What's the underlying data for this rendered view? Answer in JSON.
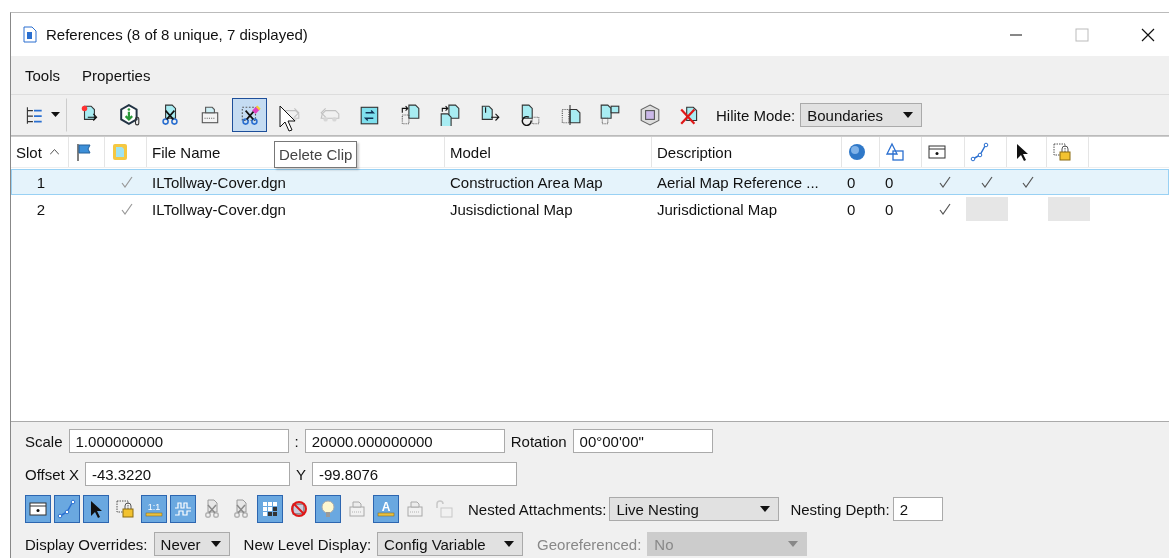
{
  "window": {
    "title": "References (8 of 8 unique, 7 displayed)"
  },
  "menu": [
    {
      "label": "Tools"
    },
    {
      "label": "Properties"
    }
  ],
  "toolbar": {
    "tools": [
      {
        "kind": "tree",
        "disabled": false,
        "selected": false
      },
      {
        "kind": "attach",
        "disabled": false,
        "selected": false
      },
      {
        "kind": "info",
        "disabled": false,
        "selected": false
      },
      {
        "kind": "clip",
        "disabled": false,
        "selected": false
      },
      {
        "kind": "mask",
        "disabled": false,
        "selected": false
      },
      {
        "kind": "clipdelete",
        "disabled": false,
        "selected": true
      },
      {
        "kind": "carright",
        "disabled": true,
        "selected": false
      },
      {
        "kind": "carleft",
        "disabled": true,
        "selected": false
      },
      {
        "kind": "reload",
        "disabled": false,
        "selected": false
      },
      {
        "kind": "copy",
        "disabled": false,
        "selected": false
      },
      {
        "kind": "move",
        "disabled": false,
        "selected": false
      },
      {
        "kind": "scale",
        "disabled": false,
        "selected": false
      },
      {
        "kind": "rotate",
        "disabled": false,
        "selected": false
      },
      {
        "kind": "mirrorh",
        "disabled": false,
        "selected": false
      },
      {
        "kind": "mirrorv",
        "disabled": false,
        "selected": false
      },
      {
        "kind": "cube",
        "disabled": false,
        "selected": false
      },
      {
        "kind": "detach",
        "disabled": false,
        "selected": false
      }
    ],
    "hilite": {
      "label": "Hilite Mode:",
      "value": "Boundaries"
    },
    "tooltip": "Delete Clip"
  },
  "table": {
    "columns": [
      {
        "kind": "text",
        "label": "Slot",
        "sorted": true
      },
      {
        "kind": "flag"
      },
      {
        "kind": "filedoc"
      },
      {
        "kind": "text",
        "label": "File Name",
        "sorted": false
      },
      {
        "kind": "text",
        "label": "Model",
        "sorted": false
      },
      {
        "kind": "text",
        "label": "Description",
        "sorted": false
      },
      {
        "kind": "globe"
      },
      {
        "kind": "shapes"
      },
      {
        "kind": "window"
      },
      {
        "kind": "line"
      },
      {
        "kind": "pointer"
      },
      {
        "kind": "lock"
      }
    ],
    "rows": [
      {
        "selected": true,
        "slot": "1",
        "loaded": true,
        "file_name": "ILTollway-Cover.dgn",
        "model": "Construction Area Map",
        "description": "Aerial Map Reference ...",
        "column_7": "0",
        "column_8": "0",
        "toggles": [
          {
            "checked": true,
            "disabled": false
          },
          {
            "checked": true,
            "disabled": false
          },
          {
            "checked": true,
            "disabled": false
          },
          {
            "checked": false,
            "disabled": false
          }
        ]
      },
      {
        "selected": false,
        "slot": "2",
        "loaded": true,
        "file_name": "ILTollway-Cover.dgn",
        "model": "Jusisdictional Map",
        "description": "Jurisdictional Map",
        "column_7": "0",
        "column_8": "0",
        "toggles": [
          {
            "checked": true,
            "disabled": false
          },
          {
            "checked": false,
            "disabled": true
          },
          {
            "checked": false,
            "disabled": false
          },
          {
            "checked": false,
            "disabled": true
          }
        ]
      }
    ]
  },
  "settings": {
    "scale": {
      "label": "Scale",
      "value": "1.000000000",
      "separator": ":",
      "value_2": "20000.000000000"
    },
    "rotation": {
      "label": "Rotation",
      "value": "00°00'00\""
    },
    "offset_x": {
      "label": "Offset X",
      "value": "-43.3220"
    },
    "offset_y": {
      "label": "Y",
      "value": "-99.8076"
    },
    "toggles": [
      {
        "kind": "window",
        "disabled": false,
        "on": true
      },
      {
        "kind": "line",
        "disabled": false,
        "on": true
      },
      {
        "kind": "pointer",
        "disabled": false,
        "on": true
      },
      {
        "kind": "lock",
        "disabled": false,
        "on": false
      },
      {
        "kind": "ratio",
        "glyph": "1:1",
        "disabled": false,
        "on": true
      },
      {
        "kind": "wave",
        "disabled": false,
        "on": true
      },
      {
        "kind": "clip",
        "disabled": true,
        "on": false
      },
      {
        "kind": "clip",
        "disabled": true,
        "on": false
      },
      {
        "kind": "grid",
        "disabled": false,
        "on": true
      },
      {
        "kind": "nodisplay",
        "disabled": false,
        "on": false
      },
      {
        "kind": "bulb",
        "disabled": false,
        "on": true
      },
      {
        "kind": "mask",
        "disabled": true,
        "on": false
      },
      {
        "kind": "text",
        "glyph": "A",
        "disabled": false,
        "on": true
      },
      {
        "kind": "mask",
        "disabled": true,
        "on": false
      },
      {
        "kind": "unlock",
        "disabled": true,
        "on": false
      }
    ],
    "nested_attachments": {
      "label": "Nested Attachments:",
      "value": "Live Nesting"
    },
    "nesting_depth": {
      "label": "Nesting Depth:",
      "value": "2"
    },
    "display_overrides": {
      "label": "Display Overrides:",
      "value": "Never"
    },
    "new_level_display": {
      "label": "New Level Display:",
      "value": "Config Variable"
    },
    "georeferenced": {
      "label": "Georeferenced:",
      "value": "No",
      "disabled": true
    }
  }
}
